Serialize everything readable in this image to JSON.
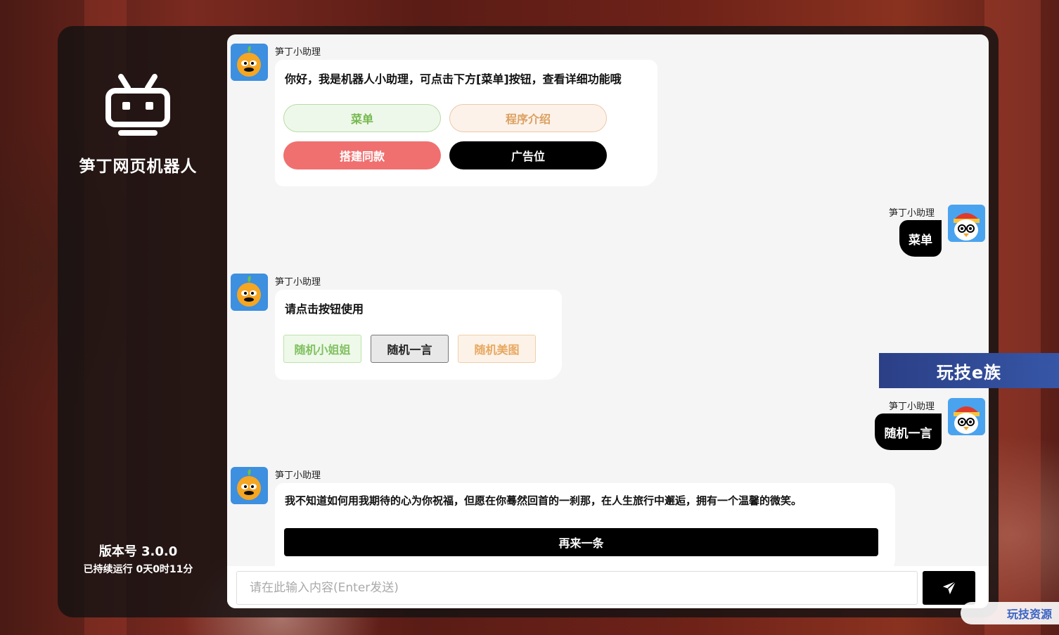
{
  "app": {
    "name": "笋丁网页机器人",
    "version": "版本号 3.0.0",
    "uptime": "已持续运行 0天0时11分"
  },
  "messages": {
    "m1": {
      "sender": "笋丁小助理",
      "text": "你好，我是机器人小助理，可点击下方[菜单]按钮，查看详细功能哦",
      "buttons": [
        "菜单",
        "程序介绍",
        "搭建同款",
        "广告位"
      ]
    },
    "m2": {
      "sender": "笋丁小助理",
      "text": "菜单"
    },
    "m3": {
      "sender": "笋丁小助理",
      "text": "请点击按钮使用",
      "buttons": [
        "随机小姐姐",
        "随机一言",
        "随机美图"
      ]
    },
    "m4": {
      "sender": "笋丁小助理",
      "text": "随机一言"
    },
    "m5": {
      "sender": "笋丁小助理",
      "text": "我不知道如何用我期待的心为你祝福，但愿在你蓦然回首的一刹那，在人生旅行中邂逅，拥有一个温馨的微笑。",
      "button": "再来一条"
    }
  },
  "input": {
    "placeholder": "请在此输入内容(Enter发送)",
    "value": ""
  },
  "watermarks": {
    "banner": "玩技e族",
    "corner": "玩技资源"
  },
  "icons": {
    "logo": "robot-icon",
    "send": "paper-plane-icon",
    "bot_avatar": "orange-duck-avatar",
    "user_avatar": "chicken-avatar"
  },
  "colors": {
    "menu_green": "#76b850",
    "intro_orange": "#dca060",
    "build_red": "#f07070",
    "ad_black": "#000000",
    "chat_bg": "#f5f5f5"
  }
}
